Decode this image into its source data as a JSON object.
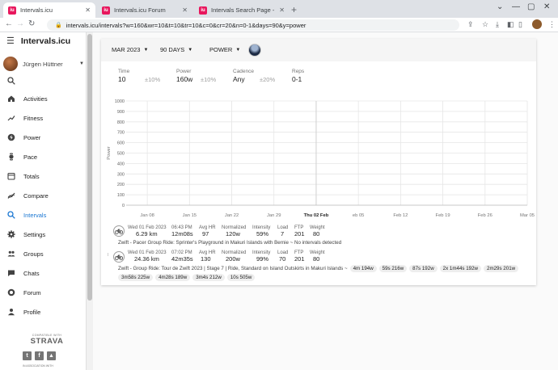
{
  "browser": {
    "tabs": [
      {
        "label": "Intervals.icu",
        "favicon": "iu",
        "active": true
      },
      {
        "label": "Intervals.icu Forum",
        "favicon": "iu",
        "active": false
      },
      {
        "label": "Intervals Search Page - Not showi",
        "favicon": "iu",
        "active": false
      }
    ],
    "url": "intervals.icu/intervals?w=160&wr=10&t=10&tr=10&c=0&cr=20&n=0-1&days=90&y=power"
  },
  "sidebar": {
    "brand": "Intervals.icu",
    "user_name": "Jürgen Hüttner",
    "items": [
      {
        "label": "Activities",
        "icon": "home-icon"
      },
      {
        "label": "Fitness",
        "icon": "trend-icon"
      },
      {
        "label": "Power",
        "icon": "lightning-icon"
      },
      {
        "label": "Pace",
        "icon": "watch-icon"
      },
      {
        "label": "Totals",
        "icon": "calendar-icon"
      },
      {
        "label": "Compare",
        "icon": "chart-icon"
      },
      {
        "label": "Intervals",
        "icon": "search-icon",
        "active": true
      },
      {
        "label": "Settings",
        "icon": "gear-icon"
      },
      {
        "label": "Groups",
        "icon": "people-icon"
      },
      {
        "label": "Chats",
        "icon": "chat-icon"
      },
      {
        "label": "Forum",
        "icon": "discourse-icon"
      },
      {
        "label": "Profile",
        "icon": "person-icon"
      }
    ],
    "strava_small": "COMPATIBLE WITH",
    "strava_big": "STRAVA",
    "assoc": "IN ASSOCIATION WITH"
  },
  "header": {
    "month": "MAR 2023",
    "days": "90 DAYS",
    "metric": "POWER"
  },
  "filters": [
    {
      "label": "Time",
      "value": "10",
      "tol": "±10%"
    },
    {
      "label": "Power",
      "value": "160w",
      "tol": "±10%"
    },
    {
      "label": "Cadence",
      "value": "Any",
      "tol": "±20%"
    },
    {
      "label": "Reps",
      "value": "0-1",
      "tol": ""
    }
  ],
  "chart_data": {
    "type": "scatter",
    "ylabel": "Power",
    "ylim": [
      0,
      1000
    ],
    "yticks": [
      0,
      100,
      200,
      300,
      400,
      500,
      600,
      700,
      800,
      900,
      1000
    ],
    "xticks": [
      "Jan 08",
      "Jan 15",
      "Jan 22",
      "Jan 29",
      "Thu 02 Feb",
      "eb 05",
      "Feb 12",
      "Feb 19",
      "Feb 26",
      "Mar 05"
    ],
    "highlight": "Thu 02 Feb",
    "series": [],
    "grid": true
  },
  "activities": [
    {
      "date": "Wed 01 Feb 2023",
      "distance": "6.29 km",
      "time_label": "06:43 PM",
      "duration": "12m08s",
      "avghr_label": "Avg HR",
      "avghr": "97",
      "np_label": "Normalized",
      "np": "120w",
      "intensity_label": "Intensity",
      "intensity": "59%",
      "load_label": "Load",
      "load": "7",
      "ftp_label": "FTP",
      "ftp": "201",
      "weight_label": "Weight",
      "weight": "80",
      "desc": "Zwift - Pacer Group Ride: Sprinter's Playground in Makuri Islands with Bernie ~ No intervals detected",
      "chips": []
    },
    {
      "date": "Wed 01 Feb 2023",
      "distance": "24.36 km",
      "time_label": "07:02 PM",
      "duration": "42m35s",
      "avghr_label": "Avg HR",
      "avghr": "130",
      "np_label": "Normalized",
      "np": "200w",
      "intensity_label": "Intensity",
      "intensity": "99%",
      "load_label": "Load",
      "load": "70",
      "ftp_label": "FTP",
      "ftp": "201",
      "weight_label": "Weight",
      "weight": "80",
      "desc": "Zwift - Group Ride: Tour de Zwift 2023 | Stage 7 | Ride, Standard on Island Outskirts in Makuri Islands ~",
      "chips": [
        "4m 194w",
        "59s 216w",
        "87s 192w",
        "2x  1m44s 192w",
        "2m29s 201w",
        "3m58s 225w",
        "4m28s 189w",
        "3m4s 212w",
        "10s 505w"
      ]
    }
  ]
}
